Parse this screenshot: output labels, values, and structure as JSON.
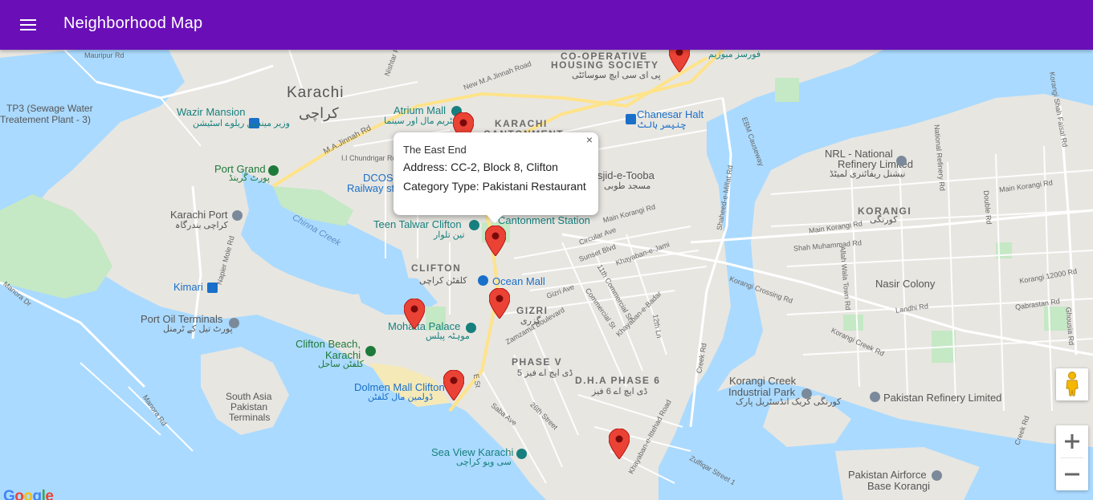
{
  "appbar": {
    "title": "Neighborhood Map",
    "menu_icon": "hamburger-menu-icon",
    "color": "#6a0fb8"
  },
  "infowindow": {
    "title": "The East End",
    "address": "Address: CC-2, Block 8, Clifton",
    "category": "Category Type: Pakistani Restaurant",
    "close_glyph": "×"
  },
  "map": {
    "colors": {
      "water": "#aadaff",
      "land": "#e8e6e1",
      "park": "#c5e8c5",
      "road_major": "#ffe38a",
      "road_minor": "#ffffff",
      "marker": "#ea4335"
    },
    "labels": {
      "karachi": "Karachi",
      "karachi_urdu": "کراچی",
      "cooperative": "CO-OPERATIVE",
      "housing_society": "HOUSING SOCIETY",
      "housing_urdu": "پی ای سی ایچ سوسائٹی",
      "karachi_cant": "KARACHI",
      "cantonment": "CANTONMENT",
      "clifton": "CLIFTON",
      "clifton_urdu": "کلفٹن کراچی",
      "gizri": "GIZRI",
      "gizri_urdu": "گزری",
      "phase_v": "PHASE V",
      "phase_v_urdu": "ڈی ایچ اے فیز 5",
      "dha_phase6": "D.H.A PHASE 6",
      "dha_phase6_urdu": "ڈی ایچ اے 6 فیز",
      "korangi": "KORANGI",
      "korangi_urdu": "کورنگی",
      "nasir_colony": "Nasir Colony",
      "tp3": "TP3 (Sewage Water",
      "tp3_line2": "Treatement Plant - 3)",
      "wazir_mansion": "Wazir Mansion",
      "wazir_urdu": "وزیر مینشن ریلوے اسٹیشن",
      "atrium_mall": "Atrium Mall",
      "atrium_urdu": "ایٹریم مال اور سینما",
      "chanesar_halt": "Chanesar Halt",
      "chanesar_urdu": "چنیسر ہالٹ",
      "masjid_tooba": "sjid-e-Tooba",
      "masjid_urdu": "مسجد طوبی",
      "port_grand": "Port Grand",
      "port_grand_urdu": "پورٹ گرینڈ",
      "dcos": "DCOS",
      "railway_sta": "Railway sta",
      "karachi_port": "Karachi Port",
      "karachi_port_urdu": "کراچی بندرگاہ",
      "teen_talwar": "Teen Talwar Clifton",
      "teen_talwar_urdu": "تین تلوار",
      "cantonment_station": "Cantonment Station",
      "chinna_creek": "Chinna Creek",
      "kimari": "Kimari",
      "ocean_mall": "Ocean Mall",
      "port_oil": "Port Oil Terminals",
      "port_oil_urdu": "پورٹ تیل کے ٹرمنل",
      "mohatta": "Mohatta Palace",
      "mohatta_urdu": "موہٹہ پیلس",
      "clifton_beach": "Clifton Beach,",
      "clifton_beach2": "Karachi",
      "clifton_beach_urdu": "کلفٹن ساحل",
      "dolmen": "Dolmen Mall Clifton",
      "dolmen_urdu": "ڈولمین مال کلفٹن",
      "south_asia": "South Asia",
      "pakistan": "Pakistan",
      "terminals": "Terminals",
      "sea_view": "Sea View Karachi",
      "sea_view_urdu": "سی ویو کراچی",
      "nrl": "NRL - National",
      "nrl2": "Refinery Limited",
      "nrl_urdu": "نیشنل ریفائنری لمیٹڈ",
      "korangi_creek_park": "Korangi Creek",
      "korangi_creek_park2": "Industrial Park",
      "korangi_creek_park_urdu": "کورنگی کریک انڈسٹریل پارک",
      "pak_refinery": "Pakistan Refinery Limited",
      "pak_airforce": "Pakistan Airforce",
      "pak_airforce2": "Base Korangi",
      "forces_museum_urdu": "فورسز میوزیم"
    },
    "roads": {
      "ma_jinnah": "M.A.Jinnah Rd",
      "new_ma_jinnah": "New M.A Jinnah Road",
      "chundrigar": "I.I Chundrigar Rd",
      "mauripur": "Mauripur Rd",
      "main_korangi": "Main Korangi Rd",
      "main_korangi2": "Main Korangi Rd",
      "main_korangi3": "Main Korangi Rd",
      "shahrah_faisal": "Korangi Shah Faisal Rd",
      "korangi_crossing": "Korangi Crossing Rd",
      "korangi_creek_rd": "Korangi Creek Rd",
      "khayaban_jami": "Khayaban-e-Jami",
      "khayaban_badar": "Khayaban-e-Badar",
      "khayaban_ittehad": "Khayaban-e-Ittehad Road",
      "sunset": "Sunset Blvd",
      "circular": "Circular Ave",
      "zamzama": "Zamzama Boulevard",
      "gizri_ave": "Gizri Ave",
      "saba": "Saba Ave",
      "street26": "26th Street",
      "commercial11": "11th Commercial St",
      "commercial": "Commercial St",
      "zulfiqar": "Zulfiqar Street 1",
      "ebm": "EBM Causeway",
      "shaheed_millat": "Shaheed-e-Millat Rd",
      "napier": "Napier Mole Rd",
      "manora": "Manora Dr",
      "landhi": "Landhi Rd",
      "qabrastan": "Qabrastan Rd",
      "shah_muhammad": "Shah Muhammad Rd",
      "allah_wala": "Allah Wala Town Rd",
      "national_refinery": "National Refinery Rd",
      "double_rd": "Double Rd",
      "korangi12000": "Korangi 12000 Rd",
      "ghousia": "Ghousia Rd",
      "creek_rd": "Creek Rd",
      "creek_rd2": "Creek Rd",
      "street12": "12th Ln",
      "e_st": "E St",
      "mancora": "Manora Rd",
      "nishtar": "Nishtar Rd"
    },
    "markers": [
      {
        "name": "marker-forces-museum"
      },
      {
        "name": "marker-karachi-cantonment"
      },
      {
        "name": "marker-the-east-end"
      },
      {
        "name": "marker-zamzama"
      },
      {
        "name": "marker-mohatta-palace"
      },
      {
        "name": "marker-dolmen-mall"
      },
      {
        "name": "marker-dha-phase-6"
      }
    ]
  },
  "controls": {
    "pegman_icon": "street-view-pegman-icon",
    "zoom_in": "+",
    "zoom_out": "−",
    "attribution": "Google"
  }
}
